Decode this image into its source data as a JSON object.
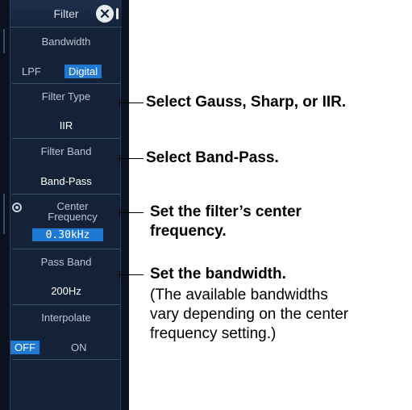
{
  "panel": {
    "title": "Filter",
    "close_glyph": "✕",
    "bandwidth": {
      "label": "Bandwidth",
      "options": [
        "LPF",
        "Digital"
      ],
      "selected": "Digital"
    },
    "filter_type": {
      "label": "Filter Type",
      "value": "IIR"
    },
    "filter_band": {
      "label": "Filter Band",
      "value": "Band-Pass"
    },
    "center_frequency": {
      "label_line1": "Center",
      "label_line2": "Frequency",
      "value": "0.30kHz"
    },
    "pass_band": {
      "label": "Pass Band",
      "value": "200Hz"
    },
    "interpolate": {
      "label": "Interpolate",
      "options": [
        "OFF",
        "ON"
      ],
      "selected": "OFF"
    }
  },
  "annotations": {
    "filter_type": "Select Gauss, Sharp, or IIR.",
    "filter_band": "Select Band-Pass.",
    "center_frequency_line1": "Set the filter’s center",
    "center_frequency_line2": "frequency.",
    "pass_band_title": "Set the bandwidth.",
    "pass_band_note_1": "(The available bandwidths",
    "pass_band_note_2": "vary depending on the center",
    "pass_band_note_3": "frequency setting.)"
  },
  "colors": {
    "panel_bg": "#142238",
    "selected_accent": "#1f78d1",
    "label_text": "#b9c3d3",
    "value_text": "#ffffff"
  }
}
